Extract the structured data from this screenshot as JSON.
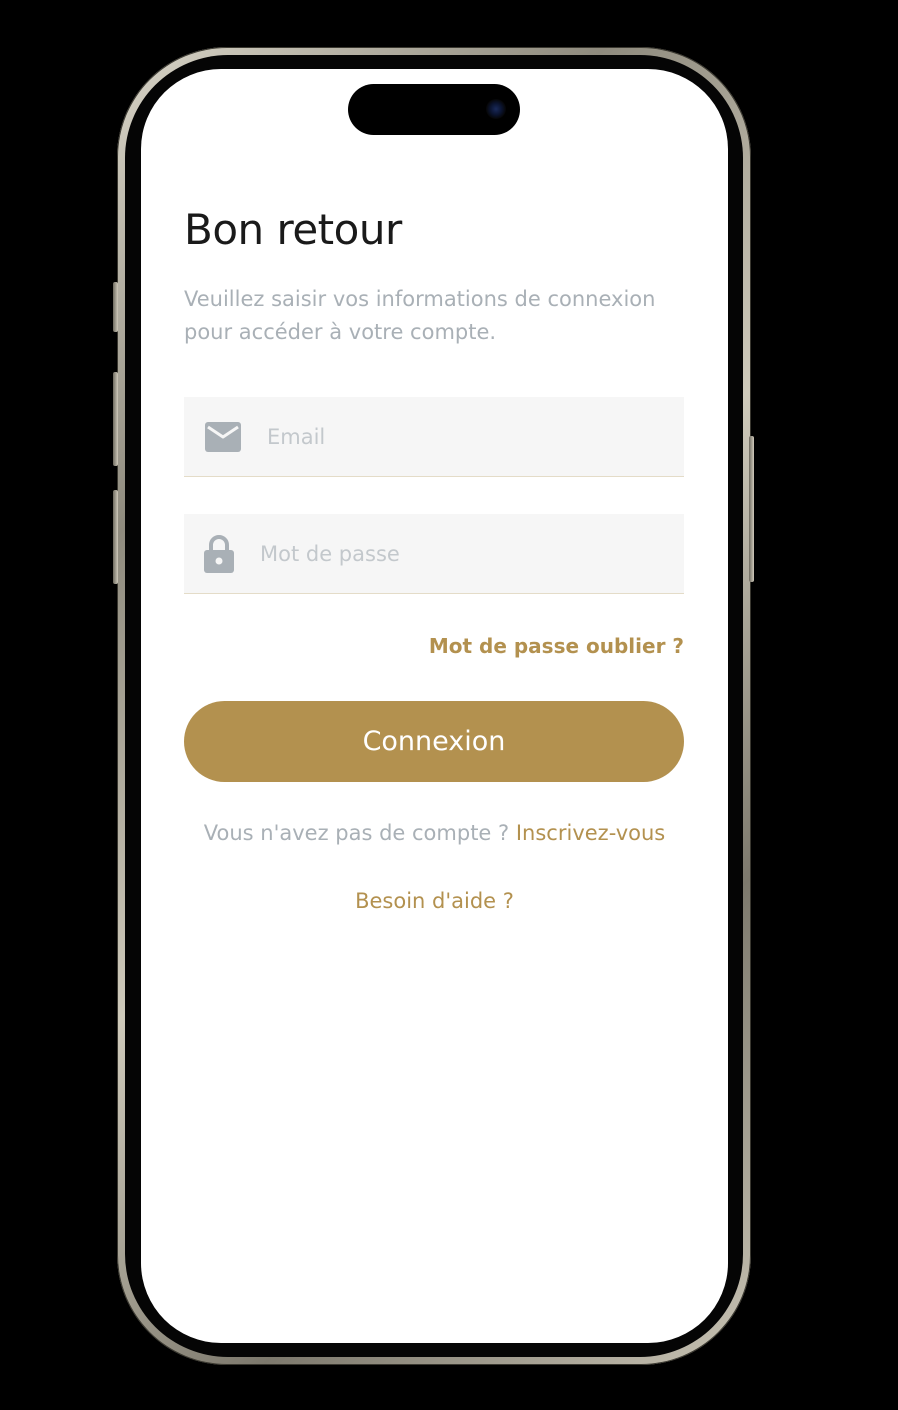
{
  "login": {
    "title": "Bon retour",
    "subtitle": "Veuillez saisir vos informations de connexion pour accéder à votre compte.",
    "email": {
      "placeholder": "Email",
      "icon": "mail-icon"
    },
    "password": {
      "placeholder": "Mot de passe",
      "icon": "lock-icon"
    },
    "forgot_label": "Mot de passe oublier ?",
    "submit_label": "Connexion",
    "signup_prompt": "Vous n'avez pas de compte ?",
    "signup_link": "Inscrivez-vous",
    "help_label": "Besoin d'aide ?"
  },
  "colors": {
    "accent": "#b3914f",
    "muted_text": "#a9b0b6",
    "field_bg": "#f6f6f6",
    "title_text": "#1a1a1a"
  }
}
